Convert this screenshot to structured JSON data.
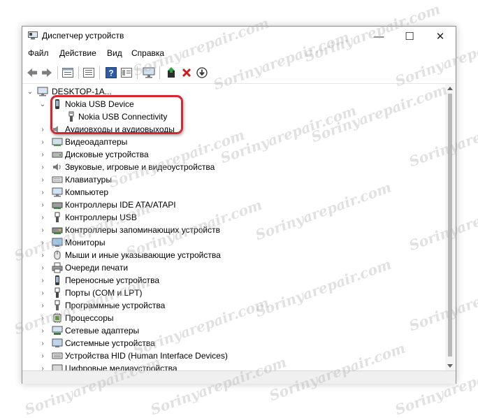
{
  "window": {
    "title": "Диспетчер устройств",
    "controls": {
      "minimize": "—",
      "maximize": "☐",
      "close": "✕"
    }
  },
  "menu": [
    "Файл",
    "Действие",
    "Вид",
    "Справка"
  ],
  "toolbar": {
    "buttons": [
      "back-icon",
      "forward-icon",
      "properties-icon",
      "details-icon",
      "help-icon",
      "view-icon",
      "monitor-scan-icon",
      "update-driver-icon",
      "uninstall-icon",
      "disable-icon"
    ]
  },
  "tree": {
    "root": "DESKTOP-1A...",
    "nokia_device": "Nokia USB Device",
    "nokia_child": "Nokia USB Connectivity",
    "categories": [
      "Аудиовходы и аудиовыходы",
      "Видеоадаптеры",
      "Дисковые устройства",
      "Звуковые, игровые и видеоустройства",
      "Клавиатуры",
      "Компьютер",
      "Контроллеры IDE ATA/ATAPI",
      "Контроллеры USB",
      "Контроллеры запоминающих устройств",
      "Мониторы",
      "Мыши и иные указывающие устройства",
      "Очереди печати",
      "Переносные устройства",
      "Порты (COM и LPT)",
      "Программные устройства",
      "Процессоры",
      "Сетевые адаптеры",
      "Системные устройства",
      "Устройства HID (Human Interface Devices)",
      "Цифровые медиаустройства"
    ]
  },
  "watermark": "Sorinyarepair.com",
  "colors": {
    "highlight_border": "#d8262e",
    "selection_accent": "#0078d7"
  }
}
